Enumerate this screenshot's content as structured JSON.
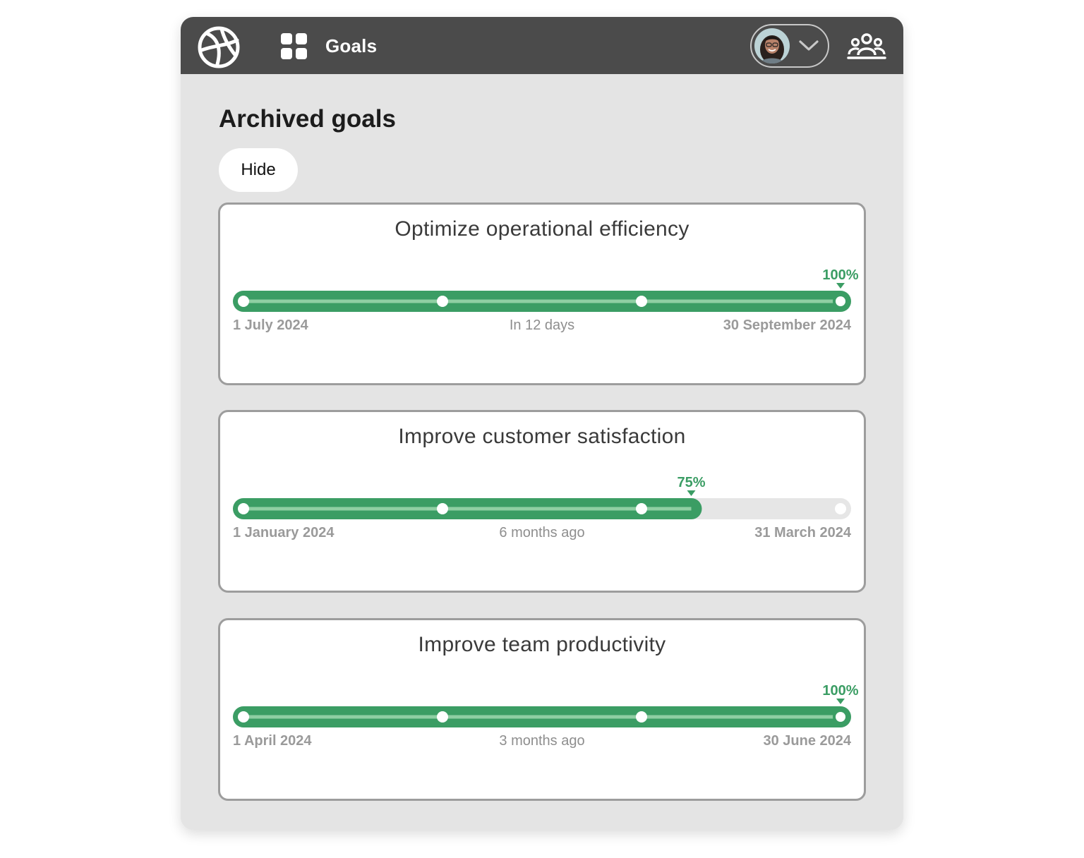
{
  "header": {
    "app_title": "Goals",
    "logo_icon": "globe-logo-icon",
    "apps_icon": "apps-grid-icon",
    "user_menu_icon": "chevron-down-icon",
    "team_icon": "team-icon"
  },
  "page": {
    "title": "Archived goals",
    "hide_button_label": "Hide"
  },
  "colors": {
    "topbar": "#4b4b4b",
    "background": "#e4e4e4",
    "progress_green": "#3b9d64",
    "progress_light": "#8fcfa3",
    "track_empty": "#e6e6e6"
  },
  "goals": [
    {
      "title": "Optimize operational efficiency",
      "start_date": "1 July 2024",
      "relative_time": "In 12 days",
      "end_date": "30 September 2024",
      "progress_label": "100%",
      "progress": 1.0,
      "milestones": 4
    },
    {
      "title": "Improve customer satisfaction",
      "start_date": "1 January 2024",
      "relative_time": "6 months ago",
      "end_date": "31 March 2024",
      "progress_label": "75%",
      "progress": 0.75,
      "milestones": 4
    },
    {
      "title": "Improve team productivity",
      "start_date": "1 April 2024",
      "relative_time": "3 months ago",
      "end_date": "30 June 2024",
      "progress_label": "100%",
      "progress": 1.0,
      "milestones": 4
    }
  ]
}
